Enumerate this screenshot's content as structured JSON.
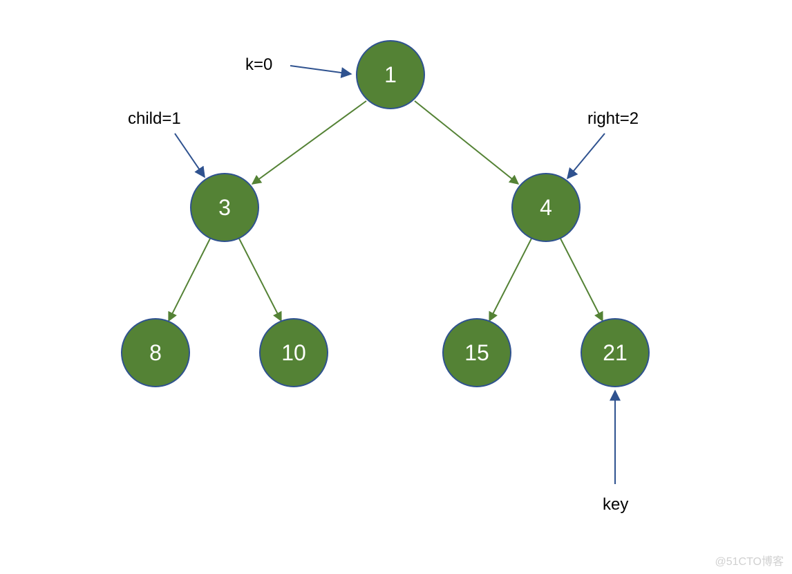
{
  "chart_data": {
    "type": "tree",
    "nodes": [
      {
        "id": 0,
        "value": 1,
        "level": 0,
        "parent": null
      },
      {
        "id": 1,
        "value": 3,
        "level": 1,
        "parent": 0,
        "side": "left"
      },
      {
        "id": 2,
        "value": 4,
        "level": 1,
        "parent": 0,
        "side": "right"
      },
      {
        "id": 3,
        "value": 8,
        "level": 2,
        "parent": 1,
        "side": "left"
      },
      {
        "id": 4,
        "value": 10,
        "level": 2,
        "parent": 1,
        "side": "right"
      },
      {
        "id": 5,
        "value": 15,
        "level": 2,
        "parent": 2,
        "side": "left"
      },
      {
        "id": 6,
        "value": 21,
        "level": 2,
        "parent": 2,
        "side": "right"
      }
    ],
    "annotations": {
      "root_label": "k=0",
      "left_child_label": "child=1",
      "right_child_label": "right=2",
      "key_label": "key"
    }
  },
  "nodes": {
    "root": "1",
    "left": "3",
    "right": "4",
    "leaf0": "8",
    "leaf1": "10",
    "leaf2": "15",
    "leaf3": "21"
  },
  "labels": {
    "k": "k=0",
    "child": "child=1",
    "right": "right=2",
    "key": "key"
  },
  "watermark": "@51CTO博客",
  "colors": {
    "node_fill": "#548235",
    "node_border": "#2F528F",
    "tree_edge": "#548235",
    "annotation_arrow": "#2F528F"
  }
}
